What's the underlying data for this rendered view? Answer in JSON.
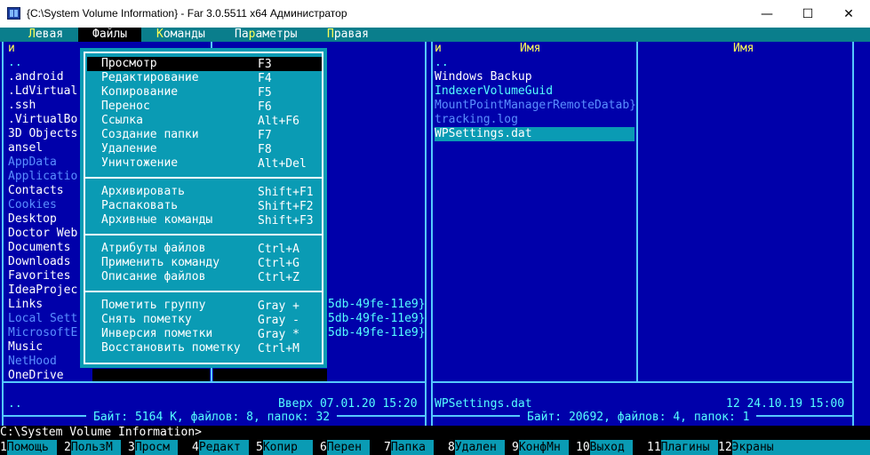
{
  "window": {
    "title": "{C:\\System Volume Information} - Far 3.0.5511 x64 Администратор",
    "minimize_glyph": "—",
    "maximize_glyph": "☐",
    "close_glyph": "✕"
  },
  "menubar": {
    "items": [
      {
        "pre": "",
        "hk": "Л",
        "post": "евая"
      },
      {
        "pre": "",
        "hk": "Ф",
        "post": "айлы"
      },
      {
        "pre": "",
        "hk": "К",
        "post": "оманды"
      },
      {
        "pre": "Па",
        "hk": "р",
        "post": "аметры"
      },
      {
        "pre": "",
        "hk": "П",
        "post": "равая"
      }
    ]
  },
  "left_panel": {
    "col_header": "и",
    "files": [
      {
        "name": "..",
        "style": "cyan"
      },
      {
        "name": ".android",
        "style": "white"
      },
      {
        "name": ".LdVirtual",
        "style": "white"
      },
      {
        "name": ".ssh",
        "style": "white"
      },
      {
        "name": ".VirtualBo",
        "style": "white"
      },
      {
        "name": "3D Objects",
        "style": "white"
      },
      {
        "name": "ansel",
        "style": "white"
      },
      {
        "name": "AppData",
        "style": "dim"
      },
      {
        "name": "Applicatio",
        "style": "dim"
      },
      {
        "name": "Contacts",
        "style": "white"
      },
      {
        "name": "Cookies",
        "style": "dim"
      },
      {
        "name": "Desktop",
        "style": "white"
      },
      {
        "name": "Doctor Web",
        "style": "white"
      },
      {
        "name": "Documents",
        "style": "white"
      },
      {
        "name": "Downloads",
        "style": "white"
      },
      {
        "name": "Favorites",
        "style": "white"
      },
      {
        "name": "IdeaProjec",
        "style": "white"
      },
      {
        "name": "Links",
        "style": "white"
      },
      {
        "name": "Local Sett",
        "style": "dim"
      },
      {
        "name": "MicrosoftE",
        "style": "dim"
      },
      {
        "name": "Music",
        "style": "white"
      },
      {
        "name": "NetHood",
        "style": "dim"
      },
      {
        "name": "OneDrive",
        "style": "white"
      }
    ],
    "guids": [
      "5db-49fe-11e9}",
      "5db-49fe-11e9}",
      "5db-49fe-11e9}"
    ],
    "status_name": "..",
    "status_info": "Вверх 07.01.20 15:20",
    "footer": "Байт: 5164 K, файлов: 8, папок: 32"
  },
  "right_panel": {
    "col_header_left": "и",
    "col_name_1": "Имя",
    "col_name_2": "Имя",
    "files": [
      {
        "name": "..",
        "style": "cyan"
      },
      {
        "name": "Windows Backup",
        "style": "white"
      },
      {
        "name": "IndexerVolumeGuid",
        "style": "cyan"
      },
      {
        "name": "MountPointManagerRemoteDatab}",
        "style": "dim"
      },
      {
        "name": "tracking.log",
        "style": "dim"
      },
      {
        "name": "WPSettings.dat",
        "style": "white",
        "selected": true
      }
    ],
    "status_name": "WPSettings.dat",
    "status_info": "12 24.10.19 15:00",
    "footer": "Байт: 20692, файлов: 4, папок: 1"
  },
  "dropdown": {
    "groups": [
      [
        {
          "label": "Просмотр",
          "key": "F3",
          "selected": true
        },
        {
          "label": "Редактирование",
          "key": "F4"
        },
        {
          "label": "Копирование",
          "key": "F5"
        },
        {
          "label": "Перенос",
          "key": "F6"
        },
        {
          "label": "Ссылка",
          "key": "Alt+F6"
        },
        {
          "label": "Создание папки",
          "key": "F7"
        },
        {
          "label": "Удаление",
          "key": "F8"
        },
        {
          "label": "Уничтожение",
          "key": "Alt+Del"
        }
      ],
      [
        {
          "label": "Архивировать",
          "key": "Shift+F1"
        },
        {
          "label": "Распаковать",
          "key": "Shift+F2"
        },
        {
          "label": "Архивные команды",
          "key": "Shift+F3"
        }
      ],
      [
        {
          "label": "Атрибуты файлов",
          "key": "Ctrl+A"
        },
        {
          "label": "Применить команду",
          "key": "Ctrl+G"
        },
        {
          "label": "Описание файлов",
          "key": "Ctrl+Z"
        }
      ],
      [
        {
          "label": "Пометить группу",
          "key": "Gray +"
        },
        {
          "label": "Снять пометку",
          "key": "Gray -"
        },
        {
          "label": "Инверсия пометки",
          "key": "Gray *"
        },
        {
          "label": "Восстановить пометку",
          "key": "Ctrl+M"
        }
      ]
    ]
  },
  "cmdline": "C:\\System Volume Information>",
  "keybar": [
    {
      "num": "1",
      "label": "Помощь"
    },
    {
      "num": "2",
      "label": "ПользМ"
    },
    {
      "num": "3",
      "label": "Просм"
    },
    {
      "num": "4",
      "label": "Редакт"
    },
    {
      "num": "5",
      "label": "Копир"
    },
    {
      "num": "6",
      "label": "Перен"
    },
    {
      "num": "7",
      "label": "Папка"
    },
    {
      "num": "8",
      "label": "Удален"
    },
    {
      "num": "9",
      "label": "КонфМн"
    },
    {
      "num": "10",
      "label": "Выход"
    },
    {
      "num": "11",
      "label": "Плагины"
    },
    {
      "num": "12",
      "label": "Экраны"
    }
  ]
}
